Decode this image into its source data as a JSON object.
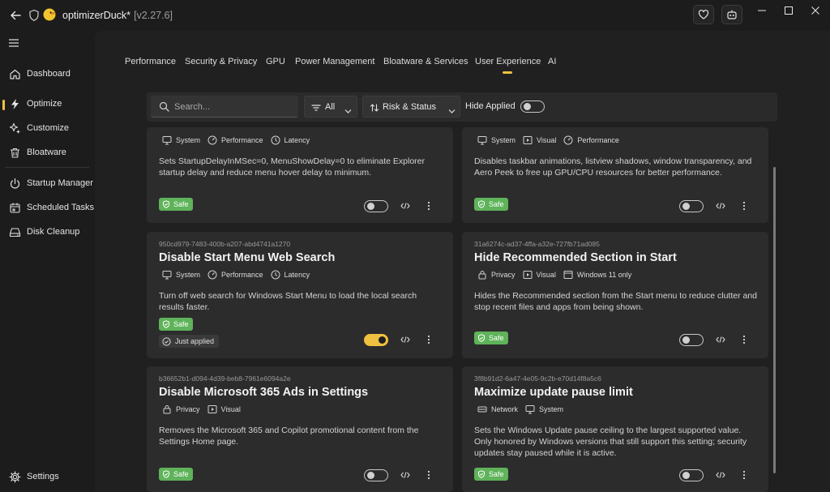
{
  "app": {
    "title": "optimizerDuck*",
    "version": "[v2.27.6]"
  },
  "sidebar": {
    "items": [
      {
        "label": "Dashboard",
        "icon": "home-icon"
      },
      {
        "label": "Optimize",
        "icon": "bolt-icon",
        "active": true
      },
      {
        "label": "Customize",
        "icon": "sparkle-icon"
      },
      {
        "label": "Bloatware",
        "icon": "trash-icon"
      },
      {
        "label": "Startup Manager",
        "icon": "power-icon"
      },
      {
        "label": "Scheduled Tasks",
        "icon": "calendar-icon"
      },
      {
        "label": "Disk Cleanup",
        "icon": "drive-icon"
      }
    ],
    "settings_label": "Settings"
  },
  "tabs": [
    "Performance",
    "Security & Privacy",
    "GPU",
    "Power Management",
    "Bloatware & Services",
    "User Experience",
    "AI"
  ],
  "active_tab": "User Experience",
  "toolbar": {
    "search_placeholder": "Search...",
    "filter_label": "All",
    "sort_label": "Risk  &  Status",
    "hide_applied_label": "Hide Applied",
    "hide_applied_on": false
  },
  "cards": [
    {
      "id": "",
      "title": "",
      "tags": [
        {
          "label": "System",
          "icon": "monitor-icon"
        },
        {
          "label": "Performance",
          "icon": "gauge-icon"
        },
        {
          "label": "Latency",
          "icon": "clock-icon"
        }
      ],
      "description": "Sets StartupDelayInMSec=0, MenuShowDelay=0 to eliminate Explorer startup delay and reduce menu hover delay to minimum.",
      "safety": "Safe",
      "status": "",
      "enabled": false
    },
    {
      "id": "",
      "title": "",
      "tags": [
        {
          "label": "System",
          "icon": "monitor-icon"
        },
        {
          "label": "Visual",
          "icon": "play-icon"
        },
        {
          "label": "Performance",
          "icon": "gauge-icon"
        }
      ],
      "description": "Disables taskbar animations, listview shadows, window transparency, and Aero Peek to free up GPU/CPU resources for better performance.",
      "safety": "Safe",
      "status": "",
      "enabled": false
    },
    {
      "id": "950cd979-7483-400b-a207-abd4741a1270",
      "title": "Disable Start Menu Web Search",
      "tags": [
        {
          "label": "System",
          "icon": "monitor-icon"
        },
        {
          "label": "Performance",
          "icon": "gauge-icon"
        },
        {
          "label": "Latency",
          "icon": "clock-icon"
        }
      ],
      "description": "Turn off web search for Windows Start Menu to load the local search results faster.",
      "safety": "Safe",
      "status": "Just applied",
      "enabled": true
    },
    {
      "id": "31a6274c-ad37-4ffa-a32e-727fb71ad085",
      "title": "Hide Recommended Section in Start",
      "tags": [
        {
          "label": "Privacy",
          "icon": "lock-icon"
        },
        {
          "label": "Visual",
          "icon": "play-icon"
        },
        {
          "label": "Windows 11 only",
          "icon": "window-icon"
        }
      ],
      "description": "Hides the Recommended section from the Start menu to reduce clutter and stop recent files and apps from being shown.",
      "safety": "Safe",
      "status": "",
      "enabled": false
    },
    {
      "id": "b36652b1-d094-4d39-beb8-7961e6094a2e",
      "title": "Disable Microsoft 365 Ads in Settings",
      "tags": [
        {
          "label": "Privacy",
          "icon": "lock-icon"
        },
        {
          "label": "Visual",
          "icon": "play-icon"
        }
      ],
      "description": "Removes the Microsoft 365 and Copilot promotional content from the Settings Home page.",
      "safety": "Safe",
      "status": "",
      "enabled": false
    },
    {
      "id": "3f8b91d2-6a47-4e05-9c2b-e70d14f8a5c6",
      "title": "Maximize update pause limit",
      "tags": [
        {
          "label": "Network",
          "icon": "network-icon"
        },
        {
          "label": "System",
          "icon": "monitor-icon"
        }
      ],
      "description": "Sets the Windows Update pause ceiling to the largest supported value. Only honored by Windows versions that still support this setting; security updates stay paused while it is active.",
      "safety": "Safe",
      "status": "",
      "enabled": false
    }
  ],
  "colors": {
    "accent": "#f0c040",
    "safe": "#5fb35a",
    "card": "#2c2c2c",
    "background": "#202020"
  }
}
